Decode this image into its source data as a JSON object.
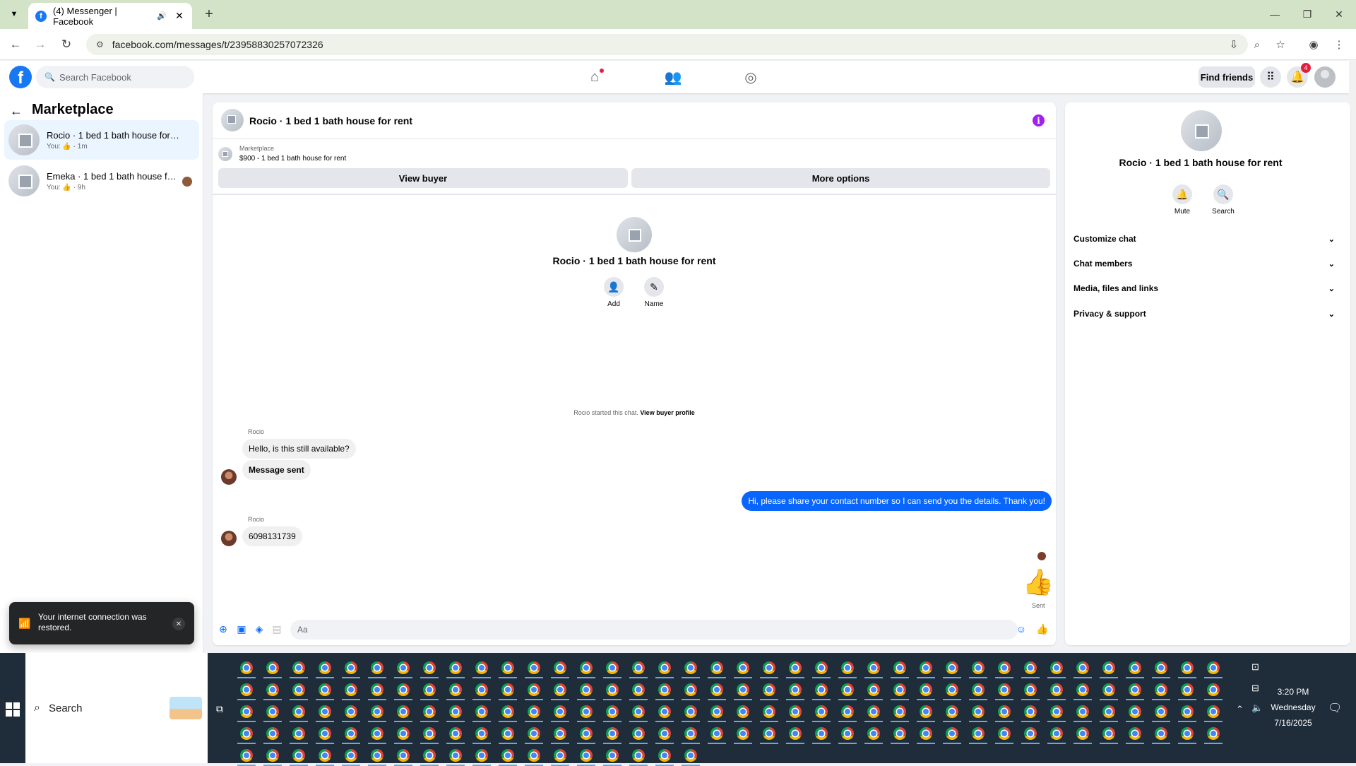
{
  "browser": {
    "tab_title": "(4) Messenger | Facebook",
    "url": "facebook.com/messages/t/23958830257072326"
  },
  "fb": {
    "search_placeholder": "Search Facebook",
    "find_friends": "Find friends",
    "notification_count": "4"
  },
  "left": {
    "title": "Marketplace",
    "conversations": [
      {
        "name": "Rocio · 1 bed 1 bath house for rent",
        "meta": "You: 👍 · 1m"
      },
      {
        "name": "Emeka · 1 bed 1 bath house for r...",
        "meta": "You: 👍 · 9h"
      }
    ]
  },
  "chat": {
    "title": "Rocio · 1 bed 1 bath house for rent",
    "marketplace_label": "Marketplace",
    "listing": "$900 - 1 bed 1 bath house for rent",
    "view_buyer": "View buyer",
    "more_options": "More options",
    "center_name": "Rocio · 1 bed 1 bath house for rent",
    "add_label": "Add",
    "name_label": "Name",
    "started_note": "Rocio started this chat.",
    "view_buyer_profile": "View buyer profile",
    "messages": [
      {
        "sender": "Rocio",
        "text": "Hello, is this still available?"
      },
      {
        "text": "Message sent"
      },
      {
        "text": "Hi, please share your contact number so I can send you the details. Thank you!"
      },
      {
        "sender": "Rocio",
        "text": "6098131739"
      }
    ],
    "sent_label": "Sent",
    "input_placeholder": "Aa"
  },
  "right": {
    "name": "Rocio · 1 bed 1 bath house for rent",
    "mute": "Mute",
    "search": "Search",
    "sections": [
      "Customize chat",
      "Chat members",
      "Media, files and links",
      "Privacy & support"
    ]
  },
  "toast": {
    "message": "Your internet connection was restored."
  },
  "taskbar": {
    "search": "Search",
    "time": "3:20 PM",
    "day": "Wednesday",
    "date": "7/16/2025"
  },
  "icons": {
    "tab": "facebook-icon",
    "nav": [
      "home-icon",
      "friends-icon",
      "groups-icon"
    ],
    "right": [
      "apps-grid-icon",
      "bell-icon",
      "profile-icon"
    ],
    "composer": [
      "plus-icon",
      "photo-icon",
      "sticker-icon",
      "gif-icon",
      "emoji-icon",
      "like-icon"
    ]
  },
  "colors": {
    "accent": "#0866ff",
    "fb_blue": "#1877f2",
    "badge": "#e41e3f",
    "info": "#a020f0"
  }
}
